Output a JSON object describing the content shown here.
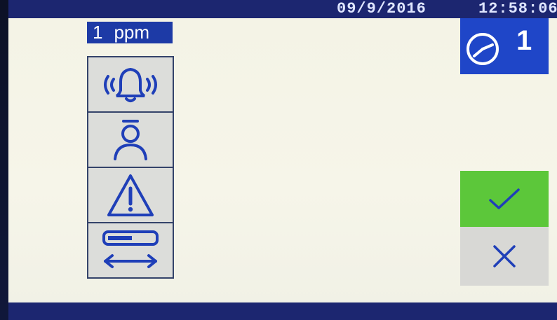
{
  "status_bar": {
    "date": "09/9/2016",
    "time": "12:58:06"
  },
  "reading": {
    "value": "1",
    "unit": "ppm"
  },
  "channel": {
    "icon": "clock-icon",
    "number": "1"
  },
  "menu": {
    "items": [
      {
        "name": "alarm",
        "icon": "ringing-bell-icon"
      },
      {
        "name": "user",
        "icon": "person-icon"
      },
      {
        "name": "warning",
        "icon": "warning-triangle-icon"
      },
      {
        "name": "range",
        "icon": "range-bar-icon"
      }
    ]
  },
  "actions": {
    "confirm_icon": "checkmark-icon",
    "cancel_icon": "close-icon"
  },
  "colors": {
    "accent_blue": "#1f46c8",
    "confirm_green": "#5cc73a",
    "icon_blue": "#1f3fb8",
    "screen_bg": "#f4f3e6"
  }
}
